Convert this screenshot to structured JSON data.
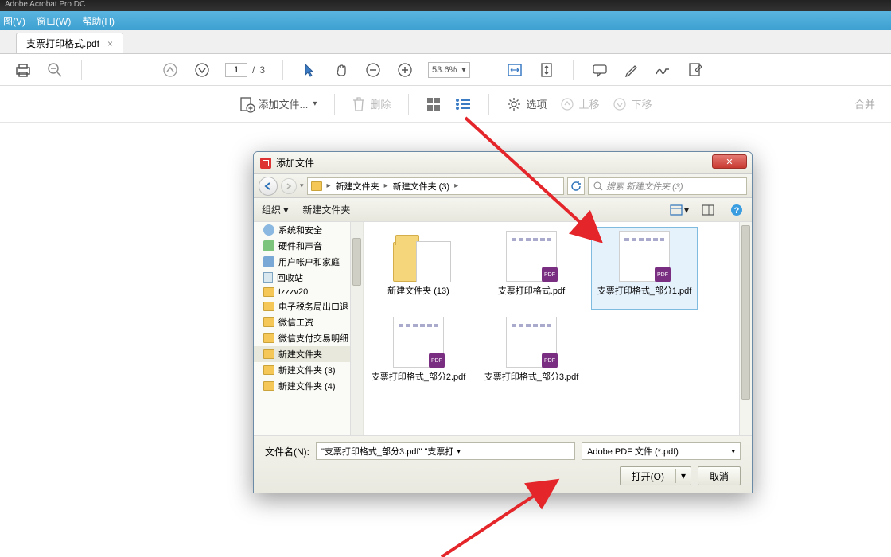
{
  "app": {
    "title": "Adobe Acrobat Pro DC"
  },
  "menu": {
    "view": "图(V)",
    "window": "窗口(W)",
    "help": "帮助(H)"
  },
  "tab": {
    "name": "支票打印格式.pdf",
    "close": "×"
  },
  "toolbar": {
    "page_current": "1",
    "page_sep": "/",
    "page_total": "3",
    "zoom": "53.6%",
    "zoom_arrow": "▾"
  },
  "actionbar": {
    "add_files": "添加文件...",
    "delete": "删除",
    "options": "选项",
    "move_up": "上移",
    "move_down": "下移",
    "merge": "合并"
  },
  "dialog": {
    "title": "添加文件",
    "close_x": "✕",
    "crumb": {
      "root": "新建文件夹",
      "sub": "新建文件夹 (3)"
    },
    "search_placeholder": "搜索 新建文件夹 (3)",
    "organize": "组织 ▾",
    "new_folder": "新建文件夹",
    "tree": [
      {
        "icon": "ctrl",
        "label": "系统和安全"
      },
      {
        "icon": "sound",
        "label": "硬件和声音"
      },
      {
        "icon": "user",
        "label": "用户帐户和家庭"
      },
      {
        "icon": "trash",
        "label": "回收站"
      },
      {
        "icon": "folder",
        "label": "tzzzv20"
      },
      {
        "icon": "folder",
        "label": "电子税务局出口退"
      },
      {
        "icon": "folder",
        "label": "微信工资"
      },
      {
        "icon": "folder",
        "label": "微信支付交易明细"
      },
      {
        "icon": "folder",
        "label": "新建文件夹",
        "sel": true
      },
      {
        "icon": "folder",
        "label": "新建文件夹 (3)"
      },
      {
        "icon": "folder",
        "label": "新建文件夹 (4)"
      }
    ],
    "files": [
      {
        "type": "folder",
        "label": "新建文件夹 (13)"
      },
      {
        "type": "pdf",
        "label": "支票打印格式.pdf"
      },
      {
        "type": "pdf",
        "label": "支票打印格式_部分1.pdf",
        "sel": true
      },
      {
        "type": "pdf",
        "label": "支票打印格式_部分2.pdf"
      },
      {
        "type": "pdf",
        "label": "支票打印格式_部分3.pdf"
      }
    ],
    "file_label": "文件名(N):",
    "file_value": "\"支票打印格式_部分3.pdf\" \"支票打",
    "type_value": "Adobe PDF 文件 (*.pdf)",
    "open": "打开(O)",
    "cancel": "取消"
  }
}
